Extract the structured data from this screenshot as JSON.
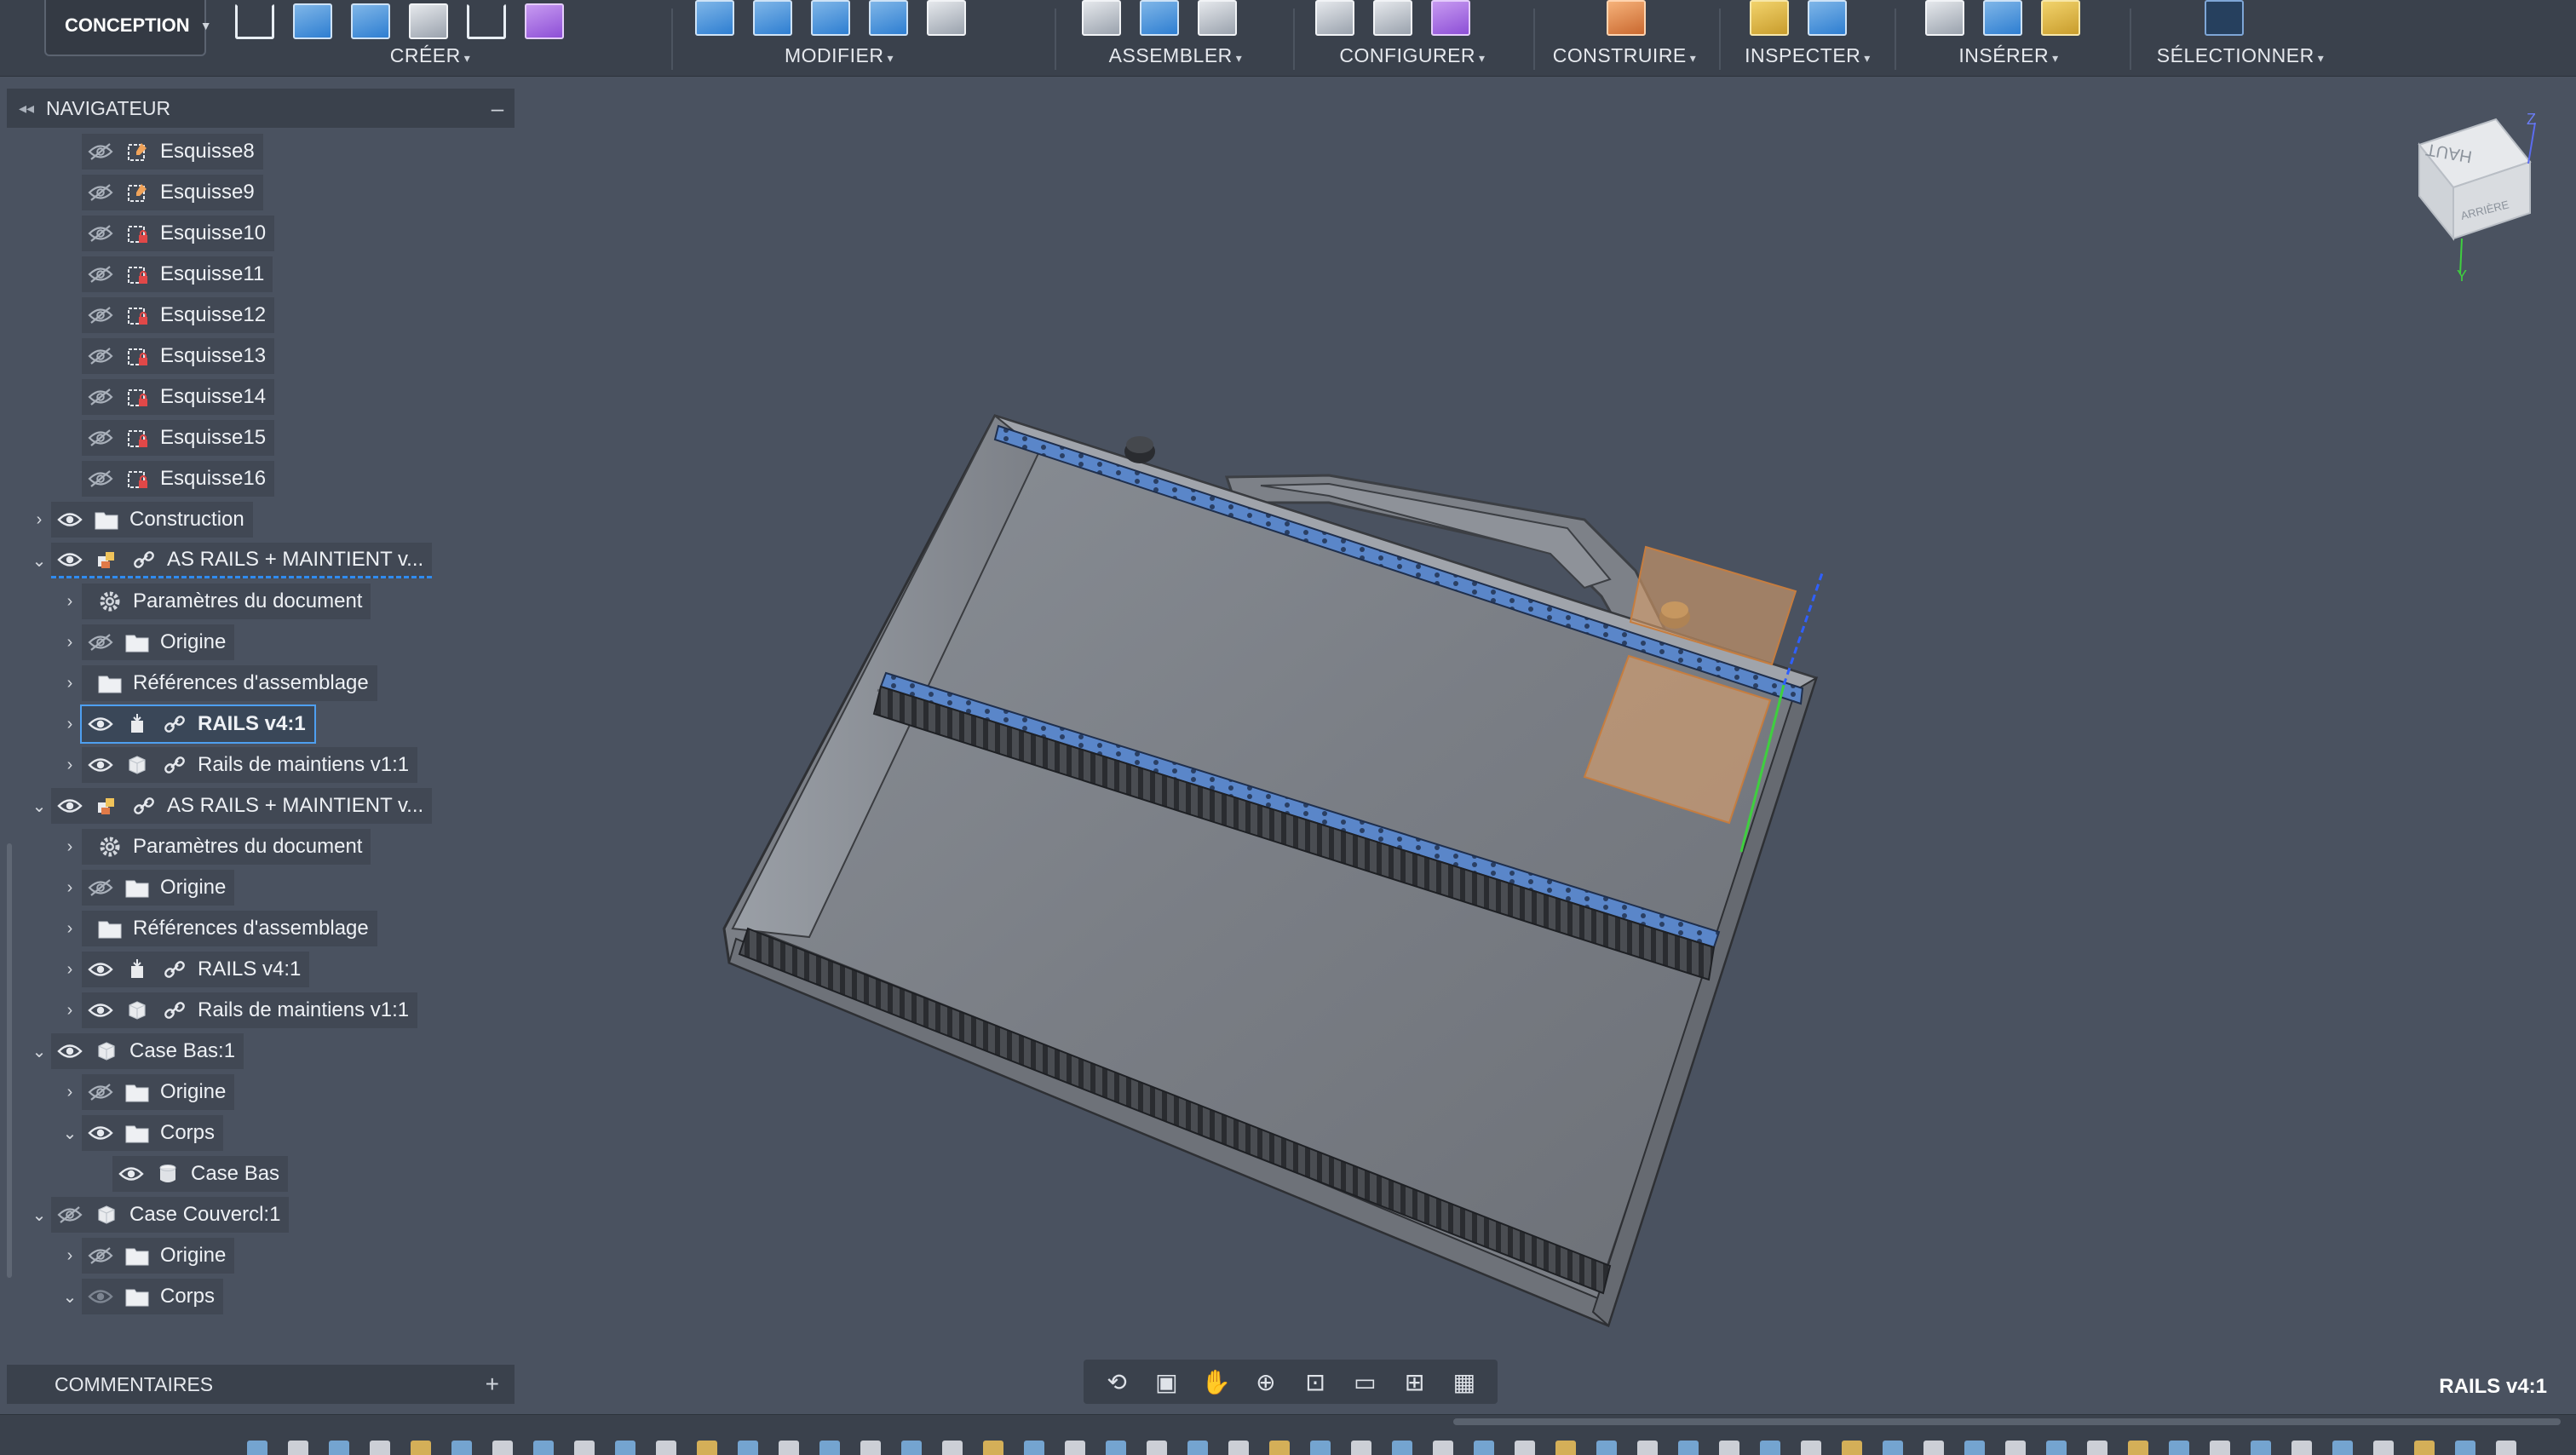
{
  "toolbar": {
    "workspace": "CONCEPTION",
    "groups": [
      {
        "label": "CRÉER"
      },
      {
        "label": "MODIFIER"
      },
      {
        "label": "ASSEMBLER"
      },
      {
        "label": "CONFIGURER"
      },
      {
        "label": "CONSTRUIRE"
      },
      {
        "label": "INSPECTER"
      },
      {
        "label": "INSÉRER"
      },
      {
        "label": "SÉLECTIONNER"
      }
    ]
  },
  "navigator": {
    "title": "NAVIGATEUR",
    "items": [
      {
        "label": "Esquisse8"
      },
      {
        "label": "Esquisse9"
      },
      {
        "label": "Esquisse10"
      },
      {
        "label": "Esquisse11"
      },
      {
        "label": "Esquisse12"
      },
      {
        "label": "Esquisse13"
      },
      {
        "label": "Esquisse14"
      },
      {
        "label": "Esquisse15"
      },
      {
        "label": "Esquisse16"
      },
      {
        "label": "Construction"
      },
      {
        "label": "AS RAILS + MAINTIENT v..."
      },
      {
        "label": "Paramètres du document"
      },
      {
        "label": "Origine"
      },
      {
        "label": "Références d'assemblage"
      },
      {
        "label": "RAILS v4:1"
      },
      {
        "label": "Rails de maintiens v1:1"
      },
      {
        "label": "AS RAILS + MAINTIENT v..."
      },
      {
        "label": "Paramètres du document"
      },
      {
        "label": "Origine"
      },
      {
        "label": "Références d'assemblage"
      },
      {
        "label": "RAILS v4:1"
      },
      {
        "label": "Rails de maintiens v1:1"
      },
      {
        "label": "Case Bas:1"
      },
      {
        "label": "Origine"
      },
      {
        "label": "Corps"
      },
      {
        "label": "Case Bas"
      },
      {
        "label": "Case Couvercl:1"
      },
      {
        "label": "Origine"
      },
      {
        "label": "Corps"
      }
    ]
  },
  "comments": {
    "title": "COMMENTAIRES"
  },
  "viewcube": {
    "face_label": "HAUT",
    "side_label": "ARRIÈRE",
    "axis_z": "Z",
    "axis_y": "Y"
  },
  "status": {
    "selection": "RAILS v4:1"
  },
  "colors": {
    "rail_blue": "#5a86c9",
    "panel_bg": "#3a414c",
    "canvas_bg": "#4a5260",
    "selection_orange": "#e8a66c"
  }
}
